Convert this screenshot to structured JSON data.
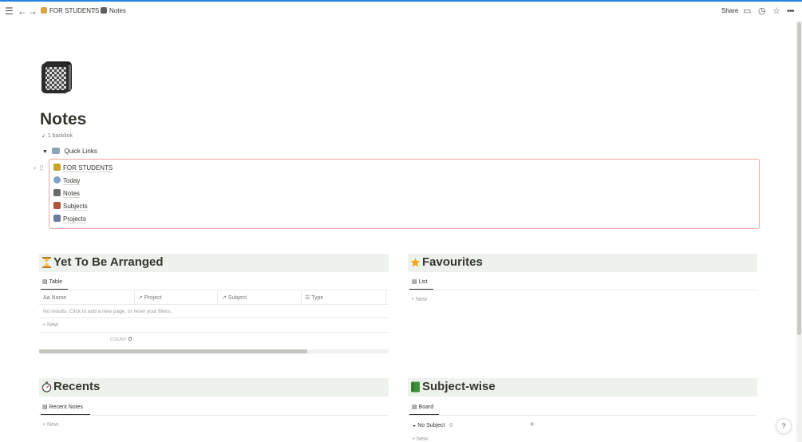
{
  "topbar": {
    "breadcrumb": [
      {
        "label": "FOR STUDENTS",
        "icon": "hourglass-icon"
      },
      {
        "label": "Notes",
        "icon": "notebook-icon"
      }
    ],
    "separator": "/",
    "share_label": "Share",
    "icons": [
      "menu-icon",
      "back-arrow-icon",
      "forward-arrow-icon",
      "comment-icon",
      "clock-icon",
      "star-icon",
      "more-icon"
    ]
  },
  "page": {
    "title": "Notes",
    "backlinks": "1 backlink",
    "icon": "notebook-icon"
  },
  "quick_links": {
    "toggle_label": "Quick Links",
    "items": [
      {
        "label": "FOR STUDENTS",
        "color": "#c9a227"
      },
      {
        "label": "Today",
        "color": "#7ea3c4"
      },
      {
        "label": "Notes",
        "color": "#6b6b6b"
      },
      {
        "label": "Subjects",
        "color": "#b0533c"
      },
      {
        "label": "Projects",
        "color": "#6a7d9b"
      }
    ]
  },
  "sections": {
    "yet_to_be_arranged": {
      "title": "Yet To Be Arranged",
      "tab": "Table",
      "columns": [
        "Name",
        "Project",
        "Subject",
        "Type"
      ],
      "empty_text": "No results. Click to add a new page, or reset your filters.",
      "new_label": "New",
      "count_label": "COUNT",
      "count_value": "0"
    },
    "favourites": {
      "title": "Favourites",
      "tab": "List",
      "new_label": "New"
    },
    "recents": {
      "title": "Recents",
      "tab": "Recent Notes",
      "new_label": "New"
    },
    "subject_wise": {
      "title": "Subject-wise",
      "tab": "Board",
      "group_label": "No Subject",
      "group_count": "0",
      "new_label": "New",
      "add_symbol": "+"
    }
  },
  "help_label": "?",
  "colors": {
    "accent": "#2383e2",
    "section_bg": "#eef2ec",
    "highlight_border": "#f0a69a"
  }
}
